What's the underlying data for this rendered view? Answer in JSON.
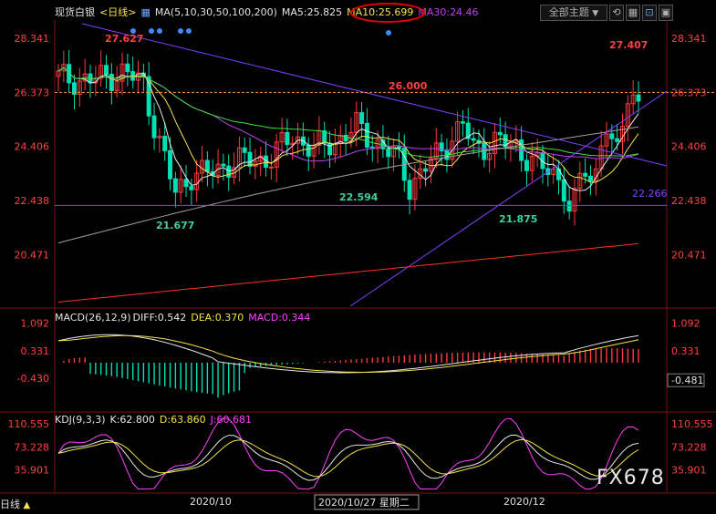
{
  "header": {
    "symbol": "现货白银",
    "period_tag": "<日线>",
    "ma_group": "MA(5,10,30,50,100,200)",
    "ma5": "MA5:25.825",
    "ma10": "MA10:25.699",
    "ma30": "MA30:24.46",
    "theme_select": "全部主题",
    "theme_arrow": "▼",
    "btn_refresh": "⟲",
    "btn_grid": "▦",
    "btn_chart": "⊡",
    "btn_close": "▣"
  },
  "macd_header": {
    "title": "MACD(26,12,9)",
    "diff": "DIFF:0.542",
    "dea": "DEA:0.370",
    "macd": "MACD:0.344"
  },
  "kdj_header": {
    "title": "KDJ(9,3,3)",
    "k": "K:62.800",
    "d": "D:63.860",
    "j": "J:60.681"
  },
  "footer": {
    "period": "日线",
    "period_arrow": "▲",
    "dates": [
      "2020/10",
      "2020/10/27 星期二",
      "2020/12"
    ]
  },
  "logo": "FX678",
  "colors": {
    "up": "#ff3b3b",
    "down": "#00e0b4",
    "ma5": "#e8e8e8",
    "ma10": "#f5e34a",
    "ma30": "#c040f0",
    "ma50": "#40e040",
    "ma100": "#a0a0a0",
    "ma200": "#ff3020",
    "trendline": "#8040ff",
    "axis_text_main": "#ff4040",
    "axis_text_macd": "#ff4040",
    "axis_text_kdj": "#ff4040"
  },
  "chart_data": [
    {
      "type": "candlestick",
      "panel": "price",
      "y_ticks": [
        28.341,
        26.373,
        24.406,
        22.438,
        20.471
      ],
      "y_tick_labels": [
        "28.341",
        "26.373",
        "24.406",
        "22.438",
        "20.471"
      ],
      "ylim": [
        18.6,
        29.0
      ],
      "x_labels": [
        "2020/10",
        "2020/10/27 星期二",
        "2020/12"
      ],
      "annotations": [
        "27.627",
        "26.000",
        "27.407",
        "22.594",
        "21.677",
        "21.875",
        "22.266"
      ],
      "reference_lines": [
        26.373,
        22.266
      ],
      "grid": false
    },
    {
      "type": "bar+line",
      "panel": "macd",
      "name": "MACD(26,12,9)",
      "y_ticks": [
        1.092,
        0.331,
        -0.43
      ],
      "y_tick_labels": [
        "1.092",
        "0.331",
        "-0.430"
      ],
      "current_label": "-0.481",
      "diff": 0.542,
      "dea": 0.37,
      "macd": 0.344
    },
    {
      "type": "line",
      "panel": "kdj",
      "name": "KDJ(9,3,3)",
      "y_ticks": [
        110.555,
        73.228,
        35.901
      ],
      "y_tick_labels": [
        "110.555",
        "73.228",
        "35.901"
      ],
      "k": 62.8,
      "d": 63.86,
      "j": 60.681
    }
  ]
}
